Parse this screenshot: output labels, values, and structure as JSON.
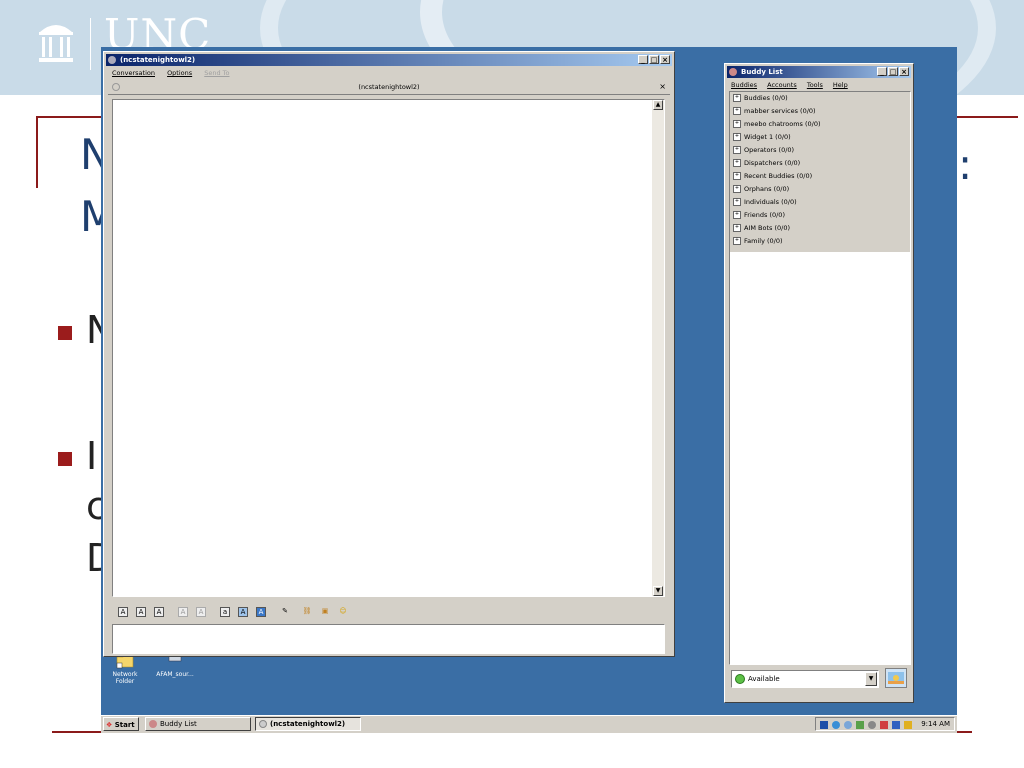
{
  "slide": {
    "logo_text": "UNC",
    "title_fragment_1": "N",
    "title_fragment_2": "M",
    "title_colon": ":",
    "bullet1_fragment": "N",
    "bullet2_fragment": "I",
    "line2_fragment": "c",
    "line3_fragment": "D",
    "accent_color": "#9b1c1c",
    "title_color": "#1f3f6e"
  },
  "conversation_window": {
    "title": "(ncstatenightowl2)",
    "menu": [
      "Conversation",
      "Options",
      "Send To"
    ],
    "tab_label": "(ncstatenightowl2)",
    "tab_close": "×",
    "window_buttons": [
      "_",
      "□",
      "×"
    ]
  },
  "buddy_list_window": {
    "title": "Buddy List",
    "menu": [
      "Buddies",
      "Accounts",
      "Tools",
      "Help"
    ],
    "groups": [
      "Buddies (0/0)",
      "mabber services (0/0)",
      "meebo chatrooms (0/0)",
      "Widget 1 (0/0)",
      "Operators (0/0)",
      "Dispatchers (0/0)",
      "Recent Buddies (0/0)",
      "Orphans (0/0)",
      "Individuals (0/0)",
      "Friends (0/0)",
      "AIM Bots (0/0)",
      "Family (0/0)"
    ],
    "status": "Available",
    "window_buttons": [
      "_",
      "□",
      "×"
    ]
  },
  "desktop": {
    "icons": [
      {
        "label_line1": "Network",
        "label_line2": "Folder",
        "icon": "folder-icon"
      },
      {
        "label_line1": "AFAM_sour...",
        "label_line2": "",
        "icon": "document-icon"
      }
    ],
    "background_color": "#3a6ea5"
  },
  "taskbar": {
    "start_label": "Start",
    "buttons": [
      "Buddy List",
      "(ncstatenightowl2)"
    ],
    "clock": "9:14 AM"
  }
}
